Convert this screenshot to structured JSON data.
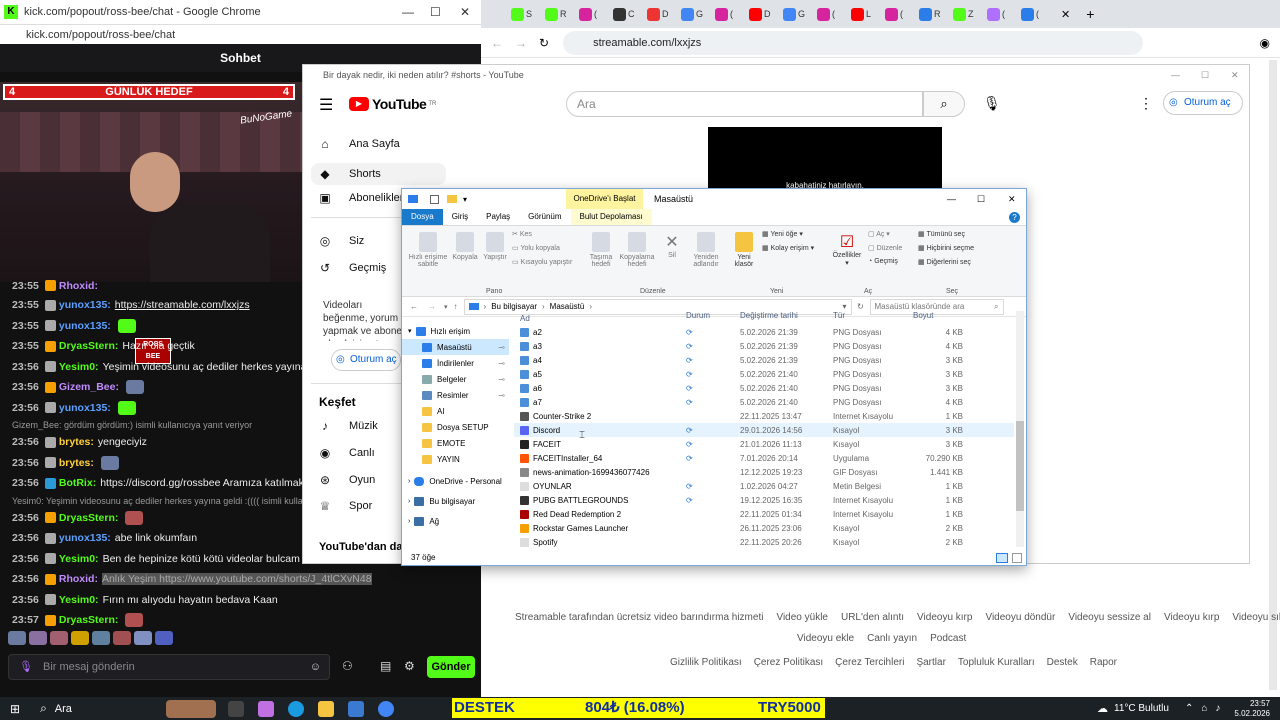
{
  "kick": {
    "window_title": "kick.com/popout/ross-bee/chat - Google Chrome",
    "url": "kick.com/popout/ross-bee/chat",
    "chat_header": "Sohbet",
    "goal_label": "GÜNLÜK HEDEF",
    "goal_left": "4",
    "goal_right": "4",
    "overlay_text": "BuNoGame",
    "cam_badge": "ROSS BEE",
    "messages": [
      {
        "time": "23:55",
        "user": "yunox135:",
        "text": "https://streamable.com/lxxjzs",
        "color": "#5aa0ff"
      },
      {
        "time": "23:55",
        "user": "yunox135:",
        "text": "",
        "color": "#5aa0ff"
      },
      {
        "time": "23:55",
        "user": "DryasStern:",
        "text": "Hazır ola geçtik",
        "color": "#53fc18"
      },
      {
        "time": "23:56",
        "user": "Yesim0:",
        "text": "Yeşimin videosunu aç dediler herkes yayına geldi",
        "color": "#53fc18"
      },
      {
        "time": "23:56",
        "user": "Gizem_Bee:",
        "text": "",
        "color": "#c08cff"
      },
      {
        "time": "23:56",
        "user": "yunox135:",
        "text": "",
        "color": "#5aa0ff"
      },
      {
        "time": "23:56",
        "user": "brytes:",
        "text": "yengeciyiz",
        "color": "#ffd23b"
      },
      {
        "time": "23:56",
        "user": "brytes:",
        "text": "",
        "color": "#ffd23b"
      },
      {
        "time": "23:56",
        "user": "BotRix:",
        "text": "https://discord.gg/rossbee Aramıza katılmak isterr",
        "color": "#53fc18"
      },
      {
        "time": "23:56",
        "user": "DryasStern:",
        "text": "",
        "color": "#53fc18"
      },
      {
        "time": "23:56",
        "user": "yunox135:",
        "text": "abe link okumfaın",
        "color": "#5aa0ff"
      },
      {
        "time": "23:56",
        "user": "Yesim0:",
        "text": "Ben de hepinize kötü kötü videolar bulcam",
        "color": "#53fc18"
      },
      {
        "time": "23:56",
        "user": "Rhoxid:",
        "text": "Anlık Yeşim https://www.youtube.com/shorts/J_4tlCXvN48",
        "color": "#c08cff"
      },
      {
        "time": "23:56",
        "user": "Yesim0:",
        "text": "Fırın mı alıyodu hayatın bedava Kaan",
        "color": "#53fc18"
      },
      {
        "time": "23:57",
        "user": "DryasStern:",
        "text": "",
        "color": "#53fc18"
      }
    ],
    "reply_1": "Gizem_Bee: gördüm gördüm:) isimli kullanıcıya yanıt veriyor",
    "reply_2": "Yesim0: Yeşimin videosunu aç dediler herkes yayına geldi :(((( isimli kulla",
    "chat_placeholder": "Bir mesaj gönderin",
    "send_label": "Gönder"
  },
  "browser": {
    "url": "streamable.com/lxxjzs",
    "tabs": [
      "S",
      "R",
      "(",
      "C",
      "D",
      "G",
      "(",
      "D",
      "G",
      "(",
      "L",
      "(",
      "R",
      "Z",
      "(",
      "("
    ]
  },
  "youtube": {
    "window_title": "Bir dayak nedir, iki neden atılır? #shorts - YouTube",
    "logo": "YouTube",
    "logo_sup": "TR",
    "search_placeholder": "Ara",
    "signin": "Oturum aç",
    "nav": [
      "Ana Sayfa",
      "Shorts",
      "Abonelikler",
      "Siz",
      "Geçmiş"
    ],
    "promo": "Videoları beğenme, yorum yapmak ve abone olmak için oturum açın.",
    "signin2": "Oturum aç",
    "kesfet": "Keşfet",
    "kesfet_items": [
      "Müzik",
      "Canlı",
      "Oyun",
      "Spor"
    ],
    "more": "YouTube'dan daha",
    "caption": "kabahatiniz hatırlayın."
  },
  "explorer": {
    "title": "Masaüstü",
    "context_tab": "OneDrive'ı Başlat",
    "context_sub": "Bulut Depolaması",
    "ribbon_tabs": [
      "Dosya",
      "Giriş",
      "Paylaş",
      "Görünüm"
    ],
    "ribbon": {
      "pin": "Hızlı erişime sabitle",
      "copy": "Kopyala",
      "paste": "Yapıştır",
      "cut": "Kes",
      "copy_path": "Yolu kopyala",
      "paste_shortcut": "Kısayolu yapıştır",
      "move": "Taşıma hedefi",
      "copy_to": "Kopyalama hedefi",
      "delete": "Sil",
      "rename": "Yeniden adlandır",
      "new_folder": "Yeni klasör",
      "new_item": "Yeni öğe",
      "easy_access": "Kolay erişim",
      "properties": "Özellikler",
      "open": "Aç",
      "edit": "Düzenle",
      "history": "Geçmiş",
      "select_all": "Tümünü seç",
      "select_none": "Hiçbirini seçme",
      "invert": "Diğerlerini seç",
      "groups": [
        "Pano",
        "Düzenle",
        "Yeni",
        "Aç",
        "Seç"
      ]
    },
    "path": [
      "Bu bilgisayar",
      "Masaüstü"
    ],
    "search_placeholder": "Masaüstü klasöründe ara",
    "sidebar": [
      "Hızlı erişim",
      "Masaüstü",
      "İndirilenler",
      "Belgeler",
      "Resimler",
      "AI",
      "Dosya SETUP",
      "EMOTE",
      "YAYIN",
      "OneDrive - Personal",
      "Bu bilgisayar",
      "Ağ"
    ],
    "columns": [
      "Ad",
      "Durum",
      "Değiştirme tarihi",
      "Tür",
      "Boyut"
    ],
    "files": [
      {
        "name": "a2",
        "sync": true,
        "date": "5.02.2026 21:39",
        "type": "PNG Dosyası",
        "size": "4 KB",
        "color": "#4a8fd8"
      },
      {
        "name": "a3",
        "sync": true,
        "date": "5.02.2026 21:39",
        "type": "PNG Dosyası",
        "size": "4 KB",
        "color": "#4a8fd8"
      },
      {
        "name": "a4",
        "sync": true,
        "date": "5.02.2026 21:39",
        "type": "PNG Dosyası",
        "size": "3 KB",
        "color": "#4a8fd8"
      },
      {
        "name": "a5",
        "sync": true,
        "date": "5.02.2026 21:40",
        "type": "PNG Dosyası",
        "size": "3 KB",
        "color": "#4a8fd8"
      },
      {
        "name": "a6",
        "sync": true,
        "date": "5.02.2026 21:40",
        "type": "PNG Dosyası",
        "size": "3 KB",
        "color": "#4a8fd8"
      },
      {
        "name": "a7",
        "sync": true,
        "date": "5.02.2026 21:40",
        "type": "PNG Dosyası",
        "size": "4 KB",
        "color": "#4a8fd8"
      },
      {
        "name": "Counter-Strike 2",
        "sync": false,
        "date": "22.11.2025 13:47",
        "type": "Internet Kısayolu",
        "size": "1 KB",
        "color": "#555"
      },
      {
        "name": "Discord",
        "sync": true,
        "date": "29.01.2026 14:56",
        "type": "Kısayol",
        "size": "3 KB",
        "color": "#5865f2"
      },
      {
        "name": "FACEIT",
        "sync": true,
        "date": "21.01.2026 11:13",
        "type": "Kısayol",
        "size": "3 KB",
        "color": "#222"
      },
      {
        "name": "FACEITInstaller_64",
        "sync": true,
        "date": "7.01.2026 20:14",
        "type": "Uygulama",
        "size": "70.290 KB",
        "color": "#ff5500"
      },
      {
        "name": "news-animation-1699436077426",
        "sync": false,
        "date": "12.12.2025 19:23",
        "type": "GIF Dosyası",
        "size": "1.441 KB",
        "color": "#888"
      },
      {
        "name": "OYUNLAR",
        "sync": true,
        "date": "1.02.2026 04:27",
        "type": "Metin Belgesi",
        "size": "1 KB",
        "color": "#ddd"
      },
      {
        "name": "PUBG BATTLEGROUNDS",
        "sync": true,
        "date": "19.12.2025 16:35",
        "type": "Internet Kısayolu",
        "size": "1 KB",
        "color": "#333"
      },
      {
        "name": "Red Dead Redemption 2",
        "sync": false,
        "date": "22.11.2025 01:34",
        "type": "Internet Kısayolu",
        "size": "1 KB",
        "color": "#a00"
      },
      {
        "name": "Rockstar Games Launcher",
        "sync": false,
        "date": "26.11.2025 23:06",
        "type": "Kısayol",
        "size": "2 KB",
        "color": "#f5a000"
      },
      {
        "name": "Spotify",
        "sync": false,
        "date": "22.11.2025 20:26",
        "type": "Kısayol",
        "size": "2 KB",
        "color": "#ddd"
      }
    ],
    "status": "37 öğe"
  },
  "streamable": {
    "row1": [
      "Streamable tarafından ücretsiz video barındırma hizmeti",
      "Video yükle",
      "URL'den alıntı",
      "Videoyu kırp",
      "Videoyu döndür",
      "Videoyu sessize al",
      "Videoyu kırp",
      "Videoyu sıkıştır"
    ],
    "row2": [
      "Videoyu ekle",
      "Canlı yayın",
      "Podcast"
    ],
    "row3": [
      "Gizlilik Politikası",
      "Çerez Politikası",
      "Çerez Tercihleri",
      "Şartlar",
      "Topluluk Kuralları",
      "Destek",
      "Rapor"
    ]
  },
  "taskbar": {
    "search": "Ara",
    "ticker": [
      "DESTEK",
      "804₺ (16.08%)",
      "TRY5000"
    ],
    "weather": "11°C  Bulutlu",
    "time": "23:57",
    "date": "5.02.2026"
  }
}
